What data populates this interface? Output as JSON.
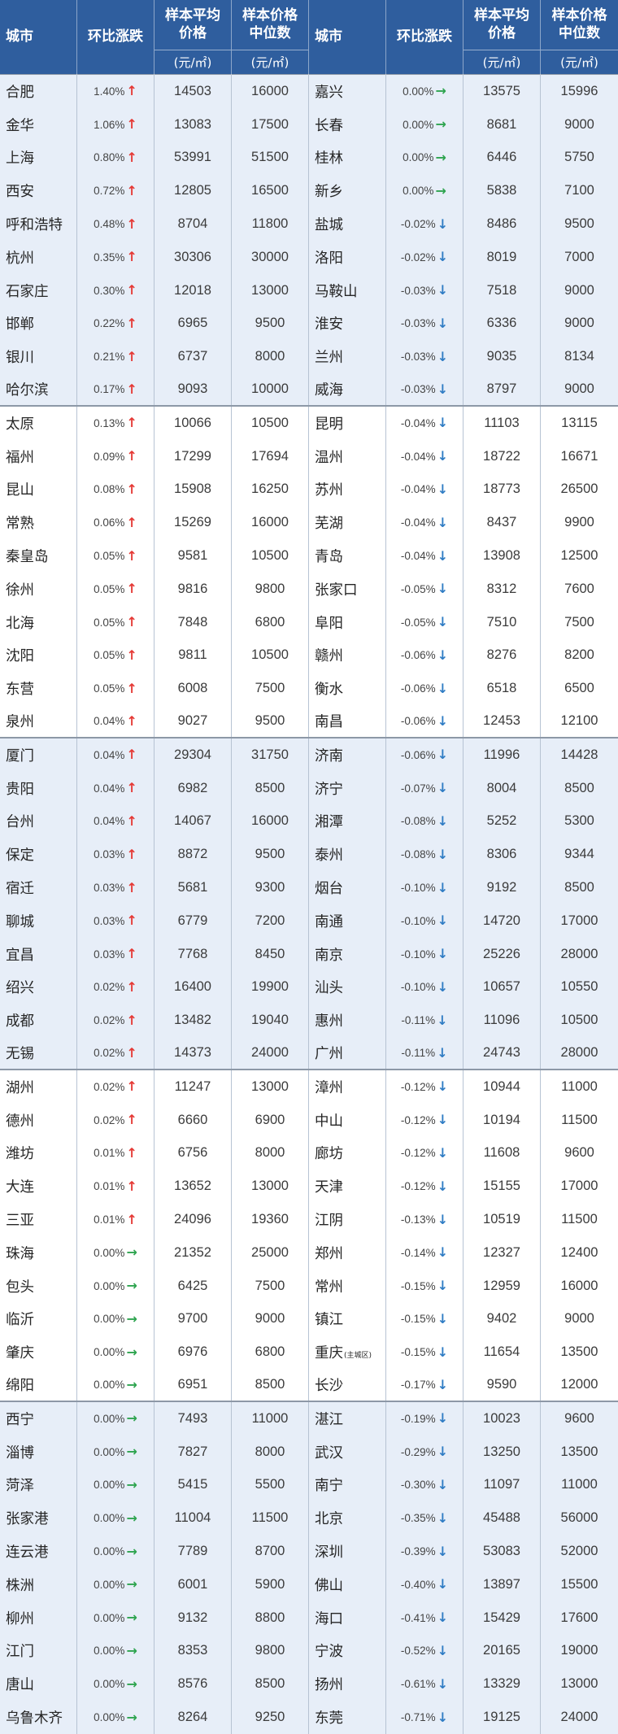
{
  "colors": {
    "header_bg": "#2f5e9e",
    "header_text": "#ffffff",
    "band_bg": "#e7eef8",
    "plain_bg": "#ffffff",
    "grid_line": "#b7c3d3",
    "group_line": "#8d98a7",
    "text": "#262626",
    "number_text": "#3b3b3b",
    "up": "#e53935",
    "flat": "#2ea44f",
    "down": "#2f7cc4"
  },
  "chart_data": {
    "type": "table",
    "header": {
      "city": "城市",
      "change": "环比涨跌",
      "avg_price": "样本平均\n价格",
      "median_price": "样本价格\n中位数",
      "unit": "(元/㎡)"
    },
    "left_rows": [
      {
        "city": "合肥",
        "change": "1.40%",
        "arrow": "up-arrow-icon",
        "avg_price": 14503,
        "median_price": 16000
      },
      {
        "city": "金华",
        "change": "1.06%",
        "arrow": "up-arrow-icon",
        "avg_price": 13083,
        "median_price": 17500
      },
      {
        "city": "上海",
        "change": "0.80%",
        "arrow": "up-arrow-icon",
        "avg_price": 53991,
        "median_price": 51500
      },
      {
        "city": "西安",
        "change": "0.72%",
        "arrow": "up-arrow-icon",
        "avg_price": 12805,
        "median_price": 16500
      },
      {
        "city": "呼和浩特",
        "change": "0.48%",
        "arrow": "up-arrow-icon",
        "avg_price": 8704,
        "median_price": 11800
      },
      {
        "city": "杭州",
        "change": "0.35%",
        "arrow": "up-arrow-icon",
        "avg_price": 30306,
        "median_price": 30000
      },
      {
        "city": "石家庄",
        "change": "0.30%",
        "arrow": "up-arrow-icon",
        "avg_price": 12018,
        "median_price": 13000
      },
      {
        "city": "邯郸",
        "change": "0.22%",
        "arrow": "up-arrow-icon",
        "avg_price": 6965,
        "median_price": 9500
      },
      {
        "city": "银川",
        "change": "0.21%",
        "arrow": "up-arrow-icon",
        "avg_price": 6737,
        "median_price": 8000
      },
      {
        "city": "哈尔滨",
        "change": "0.17%",
        "arrow": "up-arrow-icon",
        "avg_price": 9093,
        "median_price": 10000
      },
      {
        "city": "太原",
        "change": "0.13%",
        "arrow": "up-arrow-icon",
        "avg_price": 10066,
        "median_price": 10500
      },
      {
        "city": "福州",
        "change": "0.09%",
        "arrow": "up-arrow-icon",
        "avg_price": 17299,
        "median_price": 17694
      },
      {
        "city": "昆山",
        "change": "0.08%",
        "arrow": "up-arrow-icon",
        "avg_price": 15908,
        "median_price": 16250
      },
      {
        "city": "常熟",
        "change": "0.06%",
        "arrow": "up-arrow-icon",
        "avg_price": 15269,
        "median_price": 16000
      },
      {
        "city": "秦皇岛",
        "change": "0.05%",
        "arrow": "up-arrow-icon",
        "avg_price": 9581,
        "median_price": 10500
      },
      {
        "city": "徐州",
        "change": "0.05%",
        "arrow": "up-arrow-icon",
        "avg_price": 9816,
        "median_price": 9800
      },
      {
        "city": "北海",
        "change": "0.05%",
        "arrow": "up-arrow-icon",
        "avg_price": 7848,
        "median_price": 6800
      },
      {
        "city": "沈阳",
        "change": "0.05%",
        "arrow": "up-arrow-icon",
        "avg_price": 9811,
        "median_price": 10500
      },
      {
        "city": "东营",
        "change": "0.05%",
        "arrow": "up-arrow-icon",
        "avg_price": 6008,
        "median_price": 7500
      },
      {
        "city": "泉州",
        "change": "0.04%",
        "arrow": "up-arrow-icon",
        "avg_price": 9027,
        "median_price": 9500
      },
      {
        "city": "厦门",
        "change": "0.04%",
        "arrow": "up-arrow-icon",
        "avg_price": 29304,
        "median_price": 31750
      },
      {
        "city": "贵阳",
        "change": "0.04%",
        "arrow": "up-arrow-icon",
        "avg_price": 6982,
        "median_price": 8500
      },
      {
        "city": "台州",
        "change": "0.04%",
        "arrow": "up-arrow-icon",
        "avg_price": 14067,
        "median_price": 16000
      },
      {
        "city": "保定",
        "change": "0.03%",
        "arrow": "up-arrow-icon",
        "avg_price": 8872,
        "median_price": 9500
      },
      {
        "city": "宿迁",
        "change": "0.03%",
        "arrow": "up-arrow-icon",
        "avg_price": 5681,
        "median_price": 9300
      },
      {
        "city": "聊城",
        "change": "0.03%",
        "arrow": "up-arrow-icon",
        "avg_price": 6779,
        "median_price": 7200
      },
      {
        "city": "宜昌",
        "change": "0.03%",
        "arrow": "up-arrow-icon",
        "avg_price": 7768,
        "median_price": 8450
      },
      {
        "city": "绍兴",
        "change": "0.02%",
        "arrow": "up-arrow-icon",
        "avg_price": 16400,
        "median_price": 19900
      },
      {
        "city": "成都",
        "change": "0.02%",
        "arrow": "up-arrow-icon",
        "avg_price": 13482,
        "median_price": 19040
      },
      {
        "city": "无锡",
        "change": "0.02%",
        "arrow": "up-arrow-icon",
        "avg_price": 14373,
        "median_price": 24000
      },
      {
        "city": "湖州",
        "change": "0.02%",
        "arrow": "up-arrow-icon",
        "avg_price": 11247,
        "median_price": 13000
      },
      {
        "city": "德州",
        "change": "0.02%",
        "arrow": "up-arrow-icon",
        "avg_price": 6660,
        "median_price": 6900
      },
      {
        "city": "潍坊",
        "change": "0.01%",
        "arrow": "up-arrow-icon",
        "avg_price": 6756,
        "median_price": 8000
      },
      {
        "city": "大连",
        "change": "0.01%",
        "arrow": "up-arrow-icon",
        "avg_price": 13652,
        "median_price": 13000
      },
      {
        "city": "三亚",
        "change": "0.01%",
        "arrow": "up-arrow-icon",
        "avg_price": 24096,
        "median_price": 19360
      },
      {
        "city": "珠海",
        "change": "0.00%",
        "arrow": "right-arrow-icon",
        "avg_price": 21352,
        "median_price": 25000
      },
      {
        "city": "包头",
        "change": "0.00%",
        "arrow": "right-arrow-icon",
        "avg_price": 6425,
        "median_price": 7500
      },
      {
        "city": "临沂",
        "change": "0.00%",
        "arrow": "right-arrow-icon",
        "avg_price": 9700,
        "median_price": 9000
      },
      {
        "city": "肇庆",
        "change": "0.00%",
        "arrow": "right-arrow-icon",
        "avg_price": 6976,
        "median_price": 6800
      },
      {
        "city": "绵阳",
        "change": "0.00%",
        "arrow": "right-arrow-icon",
        "avg_price": 6951,
        "median_price": 8500
      },
      {
        "city": "西宁",
        "change": "0.00%",
        "arrow": "right-arrow-icon",
        "avg_price": 7493,
        "median_price": 11000
      },
      {
        "city": "淄博",
        "change": "0.00%",
        "arrow": "right-arrow-icon",
        "avg_price": 7827,
        "median_price": 8000
      },
      {
        "city": "菏泽",
        "change": "0.00%",
        "arrow": "right-arrow-icon",
        "avg_price": 5415,
        "median_price": 5500
      },
      {
        "city": "张家港",
        "change": "0.00%",
        "arrow": "right-arrow-icon",
        "avg_price": 11004,
        "median_price": 11500
      },
      {
        "city": "连云港",
        "change": "0.00%",
        "arrow": "right-arrow-icon",
        "avg_price": 7789,
        "median_price": 8700
      },
      {
        "city": "株洲",
        "change": "0.00%",
        "arrow": "right-arrow-icon",
        "avg_price": 6001,
        "median_price": 5900
      },
      {
        "city": "柳州",
        "change": "0.00%",
        "arrow": "right-arrow-icon",
        "avg_price": 9132,
        "median_price": 8800
      },
      {
        "city": "江门",
        "change": "0.00%",
        "arrow": "right-arrow-icon",
        "avg_price": 8353,
        "median_price": 9800
      },
      {
        "city": "唐山",
        "change": "0.00%",
        "arrow": "right-arrow-icon",
        "avg_price": 8576,
        "median_price": 8500
      },
      {
        "city": "乌鲁木齐",
        "change": "0.00%",
        "arrow": "right-arrow-icon",
        "avg_price": 8264,
        "median_price": 9250
      }
    ],
    "right_rows": [
      {
        "city": "嘉兴",
        "change": "0.00%",
        "arrow": "right-arrow-icon",
        "avg_price": 13575,
        "median_price": 15996
      },
      {
        "city": "长春",
        "change": "0.00%",
        "arrow": "right-arrow-icon",
        "avg_price": 8681,
        "median_price": 9000
      },
      {
        "city": "桂林",
        "change": "0.00%",
        "arrow": "right-arrow-icon",
        "avg_price": 6446,
        "median_price": 5750
      },
      {
        "city": "新乡",
        "change": "0.00%",
        "arrow": "right-arrow-icon",
        "avg_price": 5838,
        "median_price": 7100
      },
      {
        "city": "盐城",
        "change": "-0.02%",
        "arrow": "down-arrow-icon",
        "avg_price": 8486,
        "median_price": 9500
      },
      {
        "city": "洛阳",
        "change": "-0.02%",
        "arrow": "down-arrow-icon",
        "avg_price": 8019,
        "median_price": 7000
      },
      {
        "city": "马鞍山",
        "change": "-0.03%",
        "arrow": "down-arrow-icon",
        "avg_price": 7518,
        "median_price": 9000
      },
      {
        "city": "淮安",
        "change": "-0.03%",
        "arrow": "down-arrow-icon",
        "avg_price": 6336,
        "median_price": 9000
      },
      {
        "city": "兰州",
        "change": "-0.03%",
        "arrow": "down-arrow-icon",
        "avg_price": 9035,
        "median_price": 8134
      },
      {
        "city": "威海",
        "change": "-0.03%",
        "arrow": "down-arrow-icon",
        "avg_price": 8797,
        "median_price": 9000
      },
      {
        "city": "昆明",
        "change": "-0.04%",
        "arrow": "down-arrow-icon",
        "avg_price": 11103,
        "median_price": 13115
      },
      {
        "city": "温州",
        "change": "-0.04%",
        "arrow": "down-arrow-icon",
        "avg_price": 18722,
        "median_price": 16671
      },
      {
        "city": "苏州",
        "change": "-0.04%",
        "arrow": "down-arrow-icon",
        "avg_price": 18773,
        "median_price": 26500
      },
      {
        "city": "芜湖",
        "change": "-0.04%",
        "arrow": "down-arrow-icon",
        "avg_price": 8437,
        "median_price": 9900
      },
      {
        "city": "青岛",
        "change": "-0.04%",
        "arrow": "down-arrow-icon",
        "avg_price": 13908,
        "median_price": 12500
      },
      {
        "city": "张家口",
        "change": "-0.05%",
        "arrow": "down-arrow-icon",
        "avg_price": 8312,
        "median_price": 7600
      },
      {
        "city": "阜阳",
        "change": "-0.05%",
        "arrow": "down-arrow-icon",
        "avg_price": 7510,
        "median_price": 7500
      },
      {
        "city": "赣州",
        "change": "-0.06%",
        "arrow": "down-arrow-icon",
        "avg_price": 8276,
        "median_price": 8200
      },
      {
        "city": "衡水",
        "change": "-0.06%",
        "arrow": "down-arrow-icon",
        "avg_price": 6518,
        "median_price": 6500
      },
      {
        "city": "南昌",
        "change": "-0.06%",
        "arrow": "down-arrow-icon",
        "avg_price": 12453,
        "median_price": 12100
      },
      {
        "city": "济南",
        "change": "-0.06%",
        "arrow": "down-arrow-icon",
        "avg_price": 11996,
        "median_price": 14428
      },
      {
        "city": "济宁",
        "change": "-0.07%",
        "arrow": "down-arrow-icon",
        "avg_price": 8004,
        "median_price": 8500
      },
      {
        "city": "湘潭",
        "change": "-0.08%",
        "arrow": "down-arrow-icon",
        "avg_price": 5252,
        "median_price": 5300
      },
      {
        "city": "泰州",
        "change": "-0.08%",
        "arrow": "down-arrow-icon",
        "avg_price": 8306,
        "median_price": 9344
      },
      {
        "city": "烟台",
        "change": "-0.10%",
        "arrow": "down-arrow-icon",
        "avg_price": 9192,
        "median_price": 8500
      },
      {
        "city": "南通",
        "change": "-0.10%",
        "arrow": "down-arrow-icon",
        "avg_price": 14720,
        "median_price": 17000
      },
      {
        "city": "南京",
        "change": "-0.10%",
        "arrow": "down-arrow-icon",
        "avg_price": 25226,
        "median_price": 28000
      },
      {
        "city": "汕头",
        "change": "-0.10%",
        "arrow": "down-arrow-icon",
        "avg_price": 10657,
        "median_price": 10550
      },
      {
        "city": "惠州",
        "change": "-0.11%",
        "arrow": "down-arrow-icon",
        "avg_price": 11096,
        "median_price": 10500
      },
      {
        "city": "广州",
        "change": "-0.11%",
        "arrow": "down-arrow-icon",
        "avg_price": 24743,
        "median_price": 28000
      },
      {
        "city": "漳州",
        "change": "-0.12%",
        "arrow": "down-arrow-icon",
        "avg_price": 10944,
        "median_price": 11000
      },
      {
        "city": "中山",
        "change": "-0.12%",
        "arrow": "down-arrow-icon",
        "avg_price": 10194,
        "median_price": 11500
      },
      {
        "city": "廊坊",
        "change": "-0.12%",
        "arrow": "down-arrow-icon",
        "avg_price": 11608,
        "median_price": 9600
      },
      {
        "city": "天津",
        "change": "-0.12%",
        "arrow": "down-arrow-icon",
        "avg_price": 15155,
        "median_price": 17000
      },
      {
        "city": "江阴",
        "change": "-0.13%",
        "arrow": "down-arrow-icon",
        "avg_price": 10519,
        "median_price": 11500
      },
      {
        "city": "郑州",
        "change": "-0.14%",
        "arrow": "down-arrow-icon",
        "avg_price": 12327,
        "median_price": 12400
      },
      {
        "city": "常州",
        "change": "-0.15%",
        "arrow": "down-arrow-icon",
        "avg_price": 12959,
        "median_price": 16000
      },
      {
        "city": "镇江",
        "change": "-0.15%",
        "arrow": "down-arrow-icon",
        "avg_price": 9402,
        "median_price": 9000
      },
      {
        "city": "重庆",
        "city_note": "(主城区)",
        "change": "-0.15%",
        "arrow": "down-arrow-icon",
        "avg_price": 11654,
        "median_price": 13500
      },
      {
        "city": "长沙",
        "change": "-0.17%",
        "arrow": "down-arrow-icon",
        "avg_price": 9590,
        "median_price": 12000
      },
      {
        "city": "湛江",
        "change": "-0.19%",
        "arrow": "down-arrow-icon",
        "avg_price": 10023,
        "median_price": 9600
      },
      {
        "city": "武汉",
        "change": "-0.29%",
        "arrow": "down-arrow-icon",
        "avg_price": 13250,
        "median_price": 13500
      },
      {
        "city": "南宁",
        "change": "-0.30%",
        "arrow": "down-arrow-icon",
        "avg_price": 11097,
        "median_price": 11000
      },
      {
        "city": "北京",
        "change": "-0.35%",
        "arrow": "down-arrow-icon",
        "avg_price": 45488,
        "median_price": 56000
      },
      {
        "city": "深圳",
        "change": "-0.39%",
        "arrow": "down-arrow-icon",
        "avg_price": 53083,
        "median_price": 52000
      },
      {
        "city": "佛山",
        "change": "-0.40%",
        "arrow": "down-arrow-icon",
        "avg_price": 13897,
        "median_price": 15500
      },
      {
        "city": "海口",
        "change": "-0.41%",
        "arrow": "down-arrow-icon",
        "avg_price": 15429,
        "median_price": 17600
      },
      {
        "city": "宁波",
        "change": "-0.52%",
        "arrow": "down-arrow-icon",
        "avg_price": 20165,
        "median_price": 19000
      },
      {
        "city": "扬州",
        "change": "-0.61%",
        "arrow": "down-arrow-icon",
        "avg_price": 13329,
        "median_price": 13000
      },
      {
        "city": "东莞",
        "change": "-0.71%",
        "arrow": "down-arrow-icon",
        "avg_price": 19125,
        "median_price": 24000
      }
    ]
  }
}
